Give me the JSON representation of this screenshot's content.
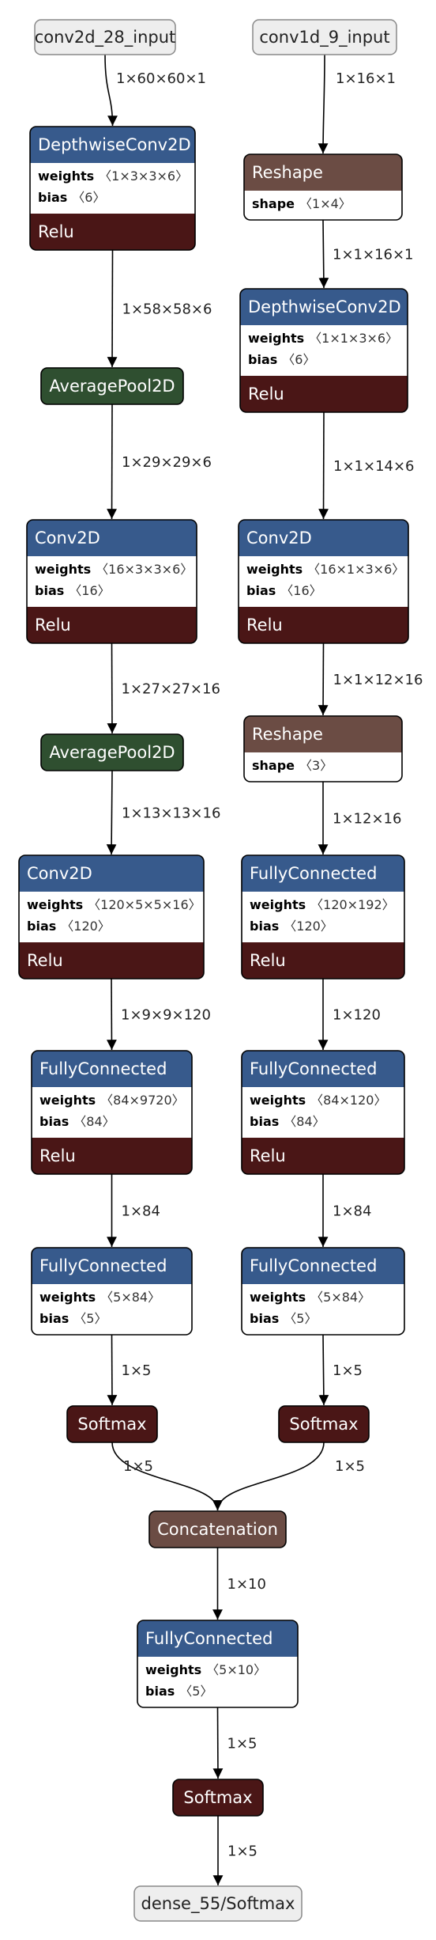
{
  "colors": {
    "layer": "#375a8c",
    "activation": "#4a1616",
    "pool": "#2f4f30",
    "shape_op": "#6b4c44",
    "io_fill": "#eeeeee",
    "edge": "#000000"
  },
  "nodes": {
    "input_a": {
      "type": "io",
      "title": "conv2d_28_input"
    },
    "dwconv_a": {
      "type": "layer",
      "title": "DepthwiseConv2D",
      "attrs": [
        {
          "key": "weights",
          "value": "〈1×3×3×6〉"
        },
        {
          "key": "bias",
          "value": "〈6〉"
        }
      ],
      "footer": "Relu"
    },
    "pool_a1": {
      "type": "pool",
      "title": "AveragePool2D"
    },
    "conv_a1": {
      "type": "layer",
      "title": "Conv2D",
      "attrs": [
        {
          "key": "weights",
          "value": "〈16×3×3×6〉"
        },
        {
          "key": "bias",
          "value": "〈16〉"
        }
      ],
      "footer": "Relu"
    },
    "pool_a2": {
      "type": "pool",
      "title": "AveragePool2D"
    },
    "conv_a2": {
      "type": "layer",
      "title": "Conv2D",
      "attrs": [
        {
          "key": "weights",
          "value": "〈120×5×5×16〉"
        },
        {
          "key": "bias",
          "value": "〈120〉"
        }
      ],
      "footer": "Relu"
    },
    "fc_a1": {
      "type": "layer",
      "title": "FullyConnected",
      "attrs": [
        {
          "key": "weights",
          "value": "〈84×9720〉"
        },
        {
          "key": "bias",
          "value": "〈84〉"
        }
      ],
      "footer": "Relu"
    },
    "fc_a2": {
      "type": "layer",
      "title": "FullyConnected",
      "attrs": [
        {
          "key": "weights",
          "value": "〈5×84〉"
        },
        {
          "key": "bias",
          "value": "〈5〉"
        }
      ]
    },
    "softmax_a": {
      "type": "activation",
      "title": "Softmax"
    },
    "input_b": {
      "type": "io",
      "title": "conv1d_9_input"
    },
    "reshape_b1": {
      "type": "shape_op",
      "title": "Reshape",
      "attrs": [
        {
          "key": "shape",
          "value": "〈1×4〉"
        }
      ]
    },
    "dwconv_b": {
      "type": "layer",
      "title": "DepthwiseConv2D",
      "attrs": [
        {
          "key": "weights",
          "value": "〈1×1×3×6〉"
        },
        {
          "key": "bias",
          "value": "〈6〉"
        }
      ],
      "footer": "Relu"
    },
    "conv_b": {
      "type": "layer",
      "title": "Conv2D",
      "attrs": [
        {
          "key": "weights",
          "value": "〈16×1×3×6〉"
        },
        {
          "key": "bias",
          "value": "〈16〉"
        }
      ],
      "footer": "Relu"
    },
    "reshape_b2": {
      "type": "shape_op",
      "title": "Reshape",
      "attrs": [
        {
          "key": "shape",
          "value": "〈3〉"
        }
      ]
    },
    "fc_b1": {
      "type": "layer",
      "title": "FullyConnected",
      "attrs": [
        {
          "key": "weights",
          "value": "〈120×192〉"
        },
        {
          "key": "bias",
          "value": "〈120〉"
        }
      ],
      "footer": "Relu"
    },
    "fc_b2": {
      "type": "layer",
      "title": "FullyConnected",
      "attrs": [
        {
          "key": "weights",
          "value": "〈84×120〉"
        },
        {
          "key": "bias",
          "value": "〈84〉"
        }
      ],
      "footer": "Relu"
    },
    "fc_b3": {
      "type": "layer",
      "title": "FullyConnected",
      "attrs": [
        {
          "key": "weights",
          "value": "〈5×84〉"
        },
        {
          "key": "bias",
          "value": "〈5〉"
        }
      ]
    },
    "softmax_b": {
      "type": "activation",
      "title": "Softmax"
    },
    "concat": {
      "type": "shape_op",
      "title": "Concatenation"
    },
    "fc_out": {
      "type": "layer",
      "title": "FullyConnected",
      "attrs": [
        {
          "key": "weights",
          "value": "〈5×10〉"
        },
        {
          "key": "bias",
          "value": "〈5〉"
        }
      ]
    },
    "softmax_out": {
      "type": "activation",
      "title": "Softmax"
    },
    "output": {
      "type": "io",
      "title": "dense_55/Softmax"
    }
  },
  "edges": [
    {
      "from": "input_a",
      "to": "dwconv_a",
      "label": "1×60×60×1"
    },
    {
      "from": "dwconv_a",
      "to": "pool_a1",
      "label": "1×58×58×6"
    },
    {
      "from": "pool_a1",
      "to": "conv_a1",
      "label": "1×29×29×6"
    },
    {
      "from": "conv_a1",
      "to": "pool_a2",
      "label": "1×27×27×16"
    },
    {
      "from": "pool_a2",
      "to": "conv_a2",
      "label": "1×13×13×16"
    },
    {
      "from": "conv_a2",
      "to": "fc_a1",
      "label": "1×9×9×120"
    },
    {
      "from": "fc_a1",
      "to": "fc_a2",
      "label": "1×84"
    },
    {
      "from": "fc_a2",
      "to": "softmax_a",
      "label": "1×5"
    },
    {
      "from": "softmax_a",
      "to": "concat",
      "label": "1×5"
    },
    {
      "from": "input_b",
      "to": "reshape_b1",
      "label": "1×16×1"
    },
    {
      "from": "reshape_b1",
      "to": "dwconv_b",
      "label": "1×1×16×1"
    },
    {
      "from": "dwconv_b",
      "to": "conv_b",
      "label": "1×1×14×6"
    },
    {
      "from": "conv_b",
      "to": "reshape_b2",
      "label": "1×1×12×16"
    },
    {
      "from": "reshape_b2",
      "to": "fc_b1",
      "label": "1×12×16"
    },
    {
      "from": "fc_b1",
      "to": "fc_b2",
      "label": "1×120"
    },
    {
      "from": "fc_b2",
      "to": "fc_b3",
      "label": "1×84"
    },
    {
      "from": "fc_b3",
      "to": "softmax_b",
      "label": "1×5"
    },
    {
      "from": "softmax_b",
      "to": "concat",
      "label": "1×5"
    },
    {
      "from": "concat",
      "to": "fc_out",
      "label": "1×10"
    },
    {
      "from": "fc_out",
      "to": "softmax_out",
      "label": "1×5"
    },
    {
      "from": "softmax_out",
      "to": "output",
      "label": "1×5"
    }
  ]
}
